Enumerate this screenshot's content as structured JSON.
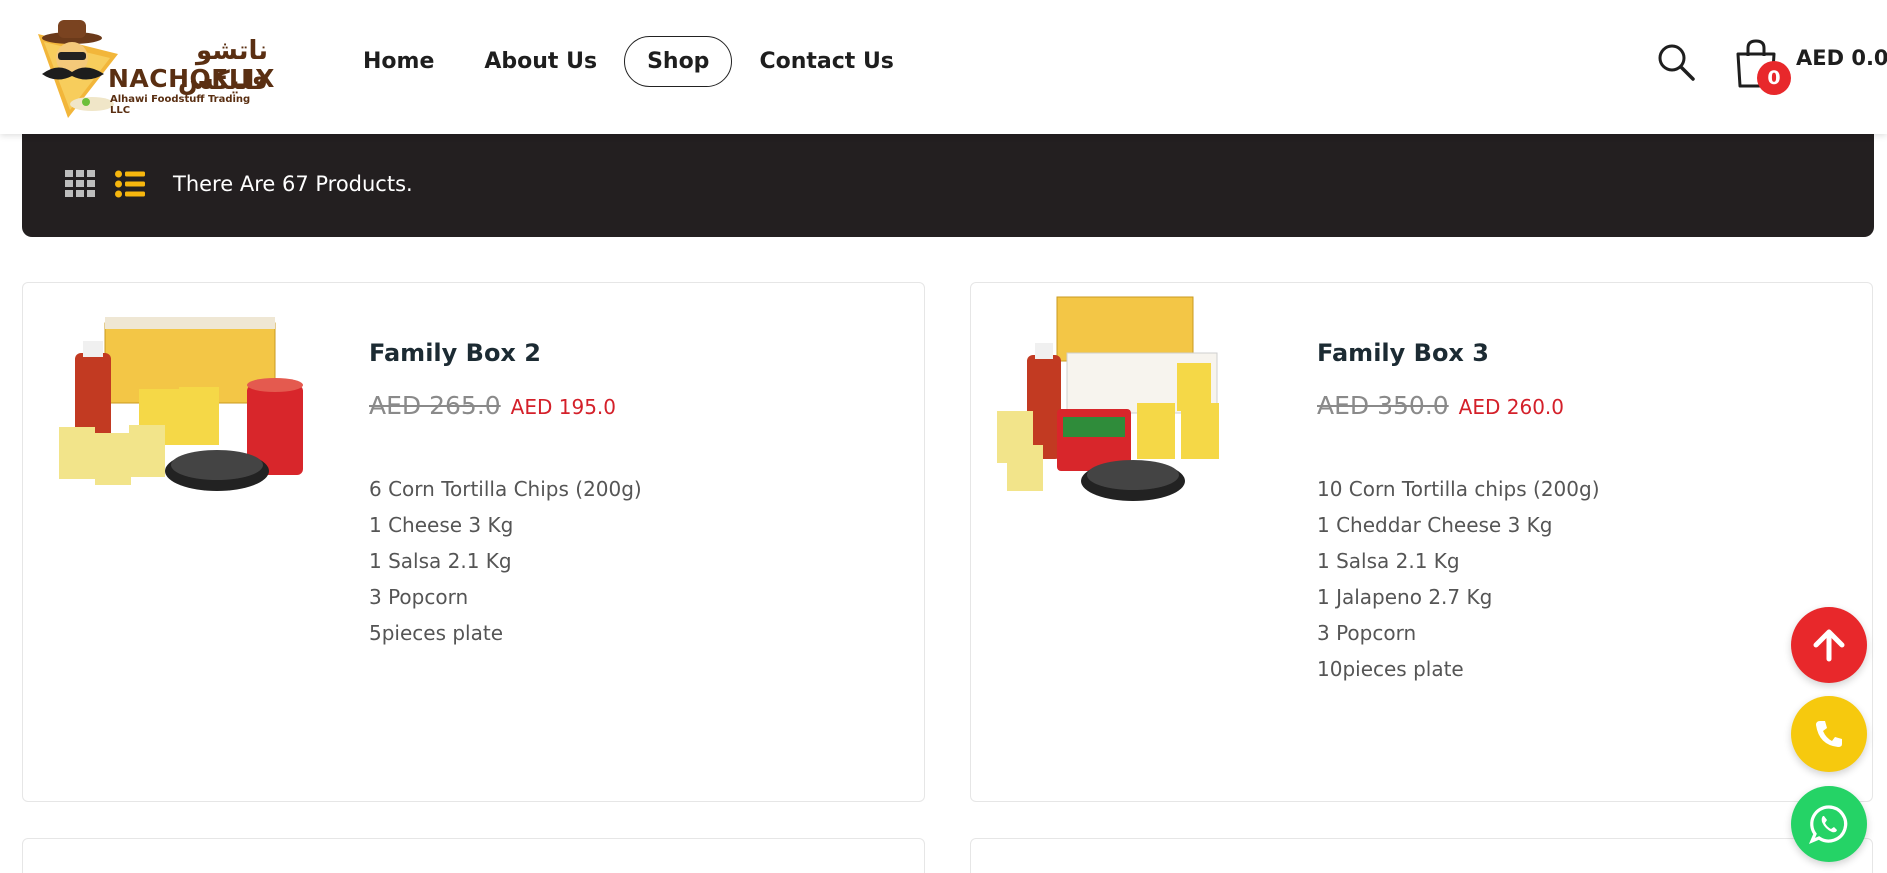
{
  "header": {
    "logo": {
      "arabic_name": "ناتشو فليكس",
      "name": "NACHOFLIX",
      "subtitle": "Alhawi Foodstuff Trading LLC"
    },
    "nav": [
      {
        "label": "Home",
        "active": false
      },
      {
        "label": "About Us",
        "active": false
      },
      {
        "label": "Shop",
        "active": true
      },
      {
        "label": "Contact Us",
        "active": false
      }
    ],
    "search_icon": "search-icon",
    "cart": {
      "icon": "shopping-bag-icon",
      "count": "0",
      "total": "AED 0.0"
    }
  },
  "toolbar": {
    "grid_view_icon": "grid-icon",
    "list_view_icon": "list-icon",
    "product_count_text": "There Are 67 Products."
  },
  "products": [
    {
      "title": "Family Box 2",
      "old_price": "AED 265.0",
      "new_price": "AED 195.0",
      "description": [
        "6 Corn Tortilla Chips (200g)",
        "1 Cheese 3 Kg",
        "1 Salsa 2.1 Kg",
        "3 Popcorn",
        "5pieces plate"
      ]
    },
    {
      "title": "Family Box 3",
      "old_price": "AED 350.0",
      "new_price": "AED 260.0",
      "description": [
        "10 Corn Tortilla chips (200g)",
        "1 Cheddar Cheese 3 Kg",
        "1 Salsa 2.1 Kg",
        "1 Jalapeno 2.7 Kg",
        "3 Popcorn",
        "10pieces plate"
      ]
    }
  ],
  "floating_buttons": [
    {
      "icon": "arrow-up-icon",
      "color": "#e8282b"
    },
    {
      "icon": "phone-icon",
      "color": "#f6c90e"
    },
    {
      "icon": "whatsapp-icon",
      "color": "#25d366"
    }
  ],
  "colors": {
    "toolbar_bg": "#231f20",
    "price_red": "#d4202a",
    "accent_yellow": "#f6c90e",
    "brand_brown": "#5a2f12"
  }
}
